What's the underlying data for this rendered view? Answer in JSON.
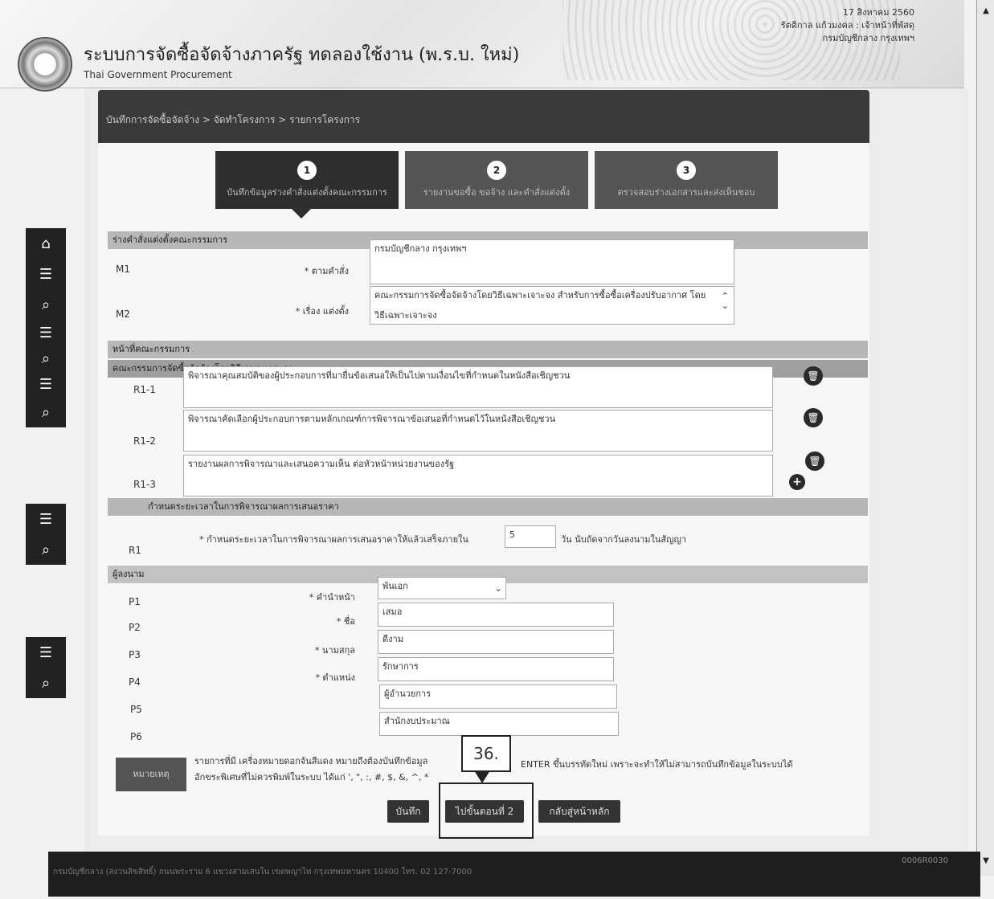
{
  "header": {
    "title": "ระบบการจัดซื้อจัดจ้างภาครัฐ ทดลองใช้งาน (พ.ร.บ. ใหม่)",
    "subtitle": "Thai Government Procurement",
    "date": "17 สิงหาคม 2560",
    "user_line": "รัตติกาล แก้วมงคล : เจ้าหน้าที่พัสดุ",
    "org_line": "กรมบัญชีกลาง กรุงเทพฯ"
  },
  "breadcrumb": "บันทึกการจัดซื้อจัดจ้าง > จัดทำโครงการ > รายการโครงการ",
  "steps": [
    {
      "num": "1",
      "label": "บันทึกข้อมูลร่างคำสั่งแต่งตั้งคณะกรรมการ"
    },
    {
      "num": "2",
      "label": "รายงานขอซื้อ ขอจ้าง และคำสั่งแต่งตั้ง"
    },
    {
      "num": "3",
      "label": "ตรวจสอบร่างเอกสารและส่งเห็นชอบ"
    }
  ],
  "section1": {
    "heading": "ร่างคำสั่งแต่งตั้งคณะกรรมการ",
    "m1": {
      "code": "M1",
      "label": "* ตามคำสั่ง",
      "value": "กรมบัญชีกลาง กรุงเทพฯ"
    },
    "m2": {
      "code": "M2",
      "label": "* เรื่อง แต่งตั้ง",
      "value_line1": "คณะกรรมการจัดซื้อจัดจ้างโดยวิธีเฉพาะเจาะจง สำหรับการซื้อซื้อเครื่องปรับอากาศ โดย",
      "value_line2": "วิธีเฉพาะเจาะจง"
    }
  },
  "section2": {
    "heading": "หน้าที่คณะกรรมการ",
    "subheading": "คณะกรรมการจัดซื้อจัดจ้างโดยวิธีเฉพาะเจาะจง",
    "rows": [
      {
        "code": "R1-1",
        "value": "พิจารณาคุณสมบัติของผู้ประกอบการที่มายื่นข้อเสนอให้เป็นไปตามเงื่อนไขที่กำหนดในหนังสือเชิญชวน"
      },
      {
        "code": "R1-2",
        "value": "พิจารณาคัดเลือกผู้ประกอบการตามหลักเกณฑ์การพิจารณาข้อเสนอที่กำหนดไว้ในหนังสือเชิญชวน"
      },
      {
        "code": "R1-3",
        "value": "รายงานผลการพิจารณาและเสนอความเห็น ต่อหัวหน้าหน่วยงานของรัฐ"
      }
    ]
  },
  "section3": {
    "heading": "กำหนดระยะเวลาในการพิจารณาผลการเสนอราคา",
    "code": "R1",
    "label": "* กำหนดระยะเวลาในการพิจารณาผลการเสนอราคาให้แล้วเสร็จภายใน",
    "value": "5",
    "suffix": "วัน นับถัดจากวันลงนามในสัญญา"
  },
  "section4": {
    "heading": "ผู้ลงนาม",
    "p1": {
      "code": "P1",
      "label": "* คำนำหน้า",
      "value": "พันเอก"
    },
    "p2": {
      "code": "P2",
      "label": "* ชื่อ",
      "value": "เสมอ"
    },
    "p3": {
      "code": "P3",
      "label": "* นามสกุล",
      "value": "ดีงาม"
    },
    "p4": {
      "code": "P4",
      "label": "* ตำแหน่ง",
      "value": "รักษาการ"
    },
    "p5": {
      "code": "P5",
      "value": "ผู้อำนวยการ"
    },
    "p6": {
      "code": "P6",
      "value": "สำนักงบประมาณ"
    }
  },
  "note": {
    "label": "หมายเหตุ",
    "line1": "รายการที่มี เครื่องหมายดอกจันสีแดง หมายถึงต้องบันทึกข้อมูล",
    "line2": "อักขระพิเศษที่ไม่ควรพิมพ์ในระบบ ได้แก่ ', \", :, #, $, &, ^, *",
    "line2_tail": "ENTER ขึ้นบรรทัดใหม่ เพราะจะทำให้ไม่สามารถบันทึกข้อมูลในระบบได้"
  },
  "buttons": {
    "save": "บันทึก",
    "next": "ไปขั้นตอนที่ 2",
    "home": "กลับสู่หน้าหลัก"
  },
  "callout": "36.",
  "footer": {
    "text": "กรมบัญชีกลาง (สงวนลิขสิทธิ์) ถนนพระราม 6 แขวงสามเสนใน เขตพญาไท กรุงเทพมหานคร 10400 โทร. 02 127-7000",
    "right": "0006R0030"
  }
}
